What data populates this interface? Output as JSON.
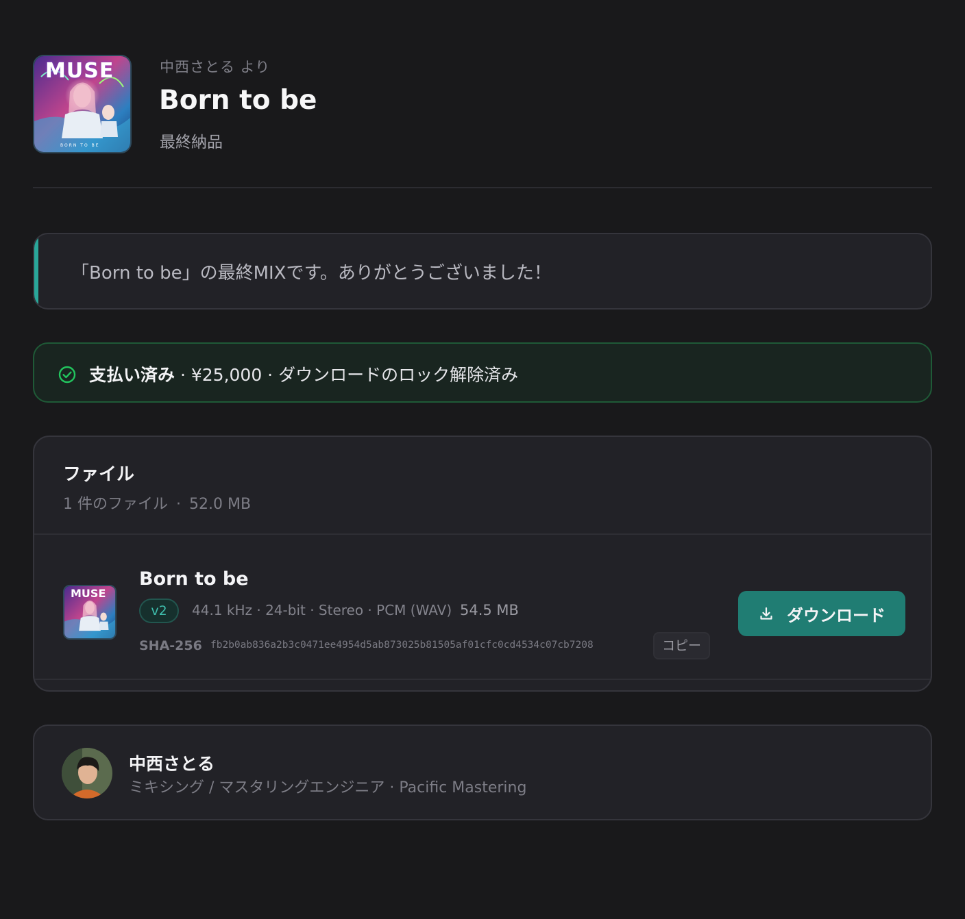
{
  "header": {
    "from_label": "中西さとる より",
    "title": "Born to be",
    "subtitle": "最終納品",
    "cover_text": "MUSE",
    "cover_caption": "BORN TO BE"
  },
  "message": {
    "text": "「Born to be」の最終MIXです。ありがとうございました！"
  },
  "payment": {
    "status": "支払い済み",
    "detail": " · ¥25,000 · ダウンロードのロック解除済み",
    "icon": "check-circle-icon"
  },
  "files": {
    "title": "ファイル",
    "count": "1 件のファイル",
    "separator": "·",
    "total_size": "52.0 MB",
    "items": [
      {
        "title": "Born to be",
        "version": "v2",
        "format": "44.1 kHz · 24-bit · Stereo · PCM (WAV)",
        "size": "54.5 MB",
        "sha_label": "SHA-256",
        "sha_value": "fb2b0ab836a2b3c0471ee4954d5ab873025b81505af01cfc0cd4534c07cb7208",
        "copy_label": "コピー",
        "download_label": "ダウンロード"
      }
    ]
  },
  "engineer": {
    "name": "中西さとる",
    "role": "ミキシング / マスタリングエンジニア · Pacific Mastering"
  },
  "colors": {
    "background": "#19191b",
    "accent": "#2aa79a",
    "download_button": "#207d73",
    "paid_border": "#1f5a37",
    "paid_icon": "#22c55e"
  }
}
